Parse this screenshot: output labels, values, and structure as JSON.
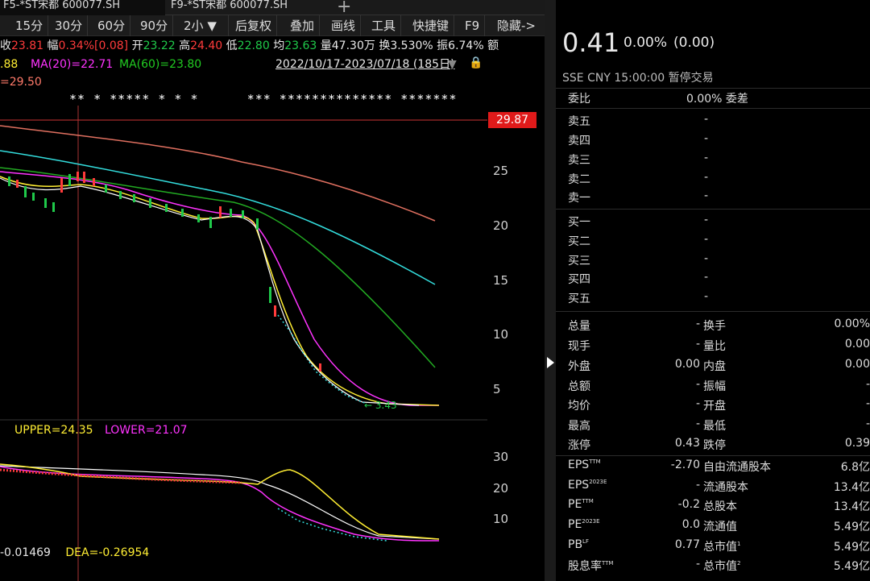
{
  "tabs": [
    {
      "label": "F5-*ST宋都 600077.SH",
      "active": true
    },
    {
      "label": "F9-*ST宋都 600077.SH",
      "active": false
    }
  ],
  "toolbar": [
    "15分",
    "30分",
    "60分",
    "90分",
    "2小",
    "后复权",
    "叠加",
    "画线",
    "工具",
    "快捷键",
    "F9",
    "隐藏->"
  ],
  "quote": {
    "close_label": "收",
    "close": "23.81",
    "range_label": "幅",
    "range": "0.34%[0.08]",
    "open_label": "开",
    "open": "23.22",
    "high_label": "高",
    "high": "24.40",
    "low_label": "低",
    "low": "22.80",
    "avg_label": "均",
    "avg": "23.63",
    "vol_label": "量",
    "vol": "47.30万",
    "turnover_label": "换",
    "turnover": "3.530%",
    "amp_label": "振",
    "amp": "6.74%",
    "amount_label": "额"
  },
  "ma": {
    "ma5": ".88",
    "ma20": "MA(20)=22.71",
    "ma60": "MA(60)=23.80",
    "prev": "=29.50",
    "date_range": "2022/10/17-2023/07/18 (185日)"
  },
  "marker_row": "** * ***** * * *      *** ************** *******",
  "main_axis": [
    "25",
    "20",
    "15",
    "10",
    "5"
  ],
  "price_tag": "29.87",
  "low_marker": "3.43",
  "boll": {
    "upper": "UPPER=24.35",
    "lower": "LOWER=21.07"
  },
  "sub_axis": [
    "30",
    "20",
    "10"
  ],
  "macd": {
    "dif": "-0.01469",
    "dea": "DEA=-0.26954"
  },
  "panel": {
    "price": "0.41",
    "chg_pct": "0.00%",
    "chg_val": "(0.00)",
    "sub_info": "SSE  CNY  15:00:00  暂停交易",
    "weibi_label": "委比",
    "weibi_val": "0.00% 委差",
    "sells": [
      {
        "label": "卖五",
        "val": "-"
      },
      {
        "label": "卖四",
        "val": "-"
      },
      {
        "label": "卖三",
        "val": "-"
      },
      {
        "label": "卖二",
        "val": "-"
      },
      {
        "label": "卖一",
        "val": "-"
      }
    ],
    "buys": [
      {
        "label": "买一",
        "val": "-"
      },
      {
        "label": "买二",
        "val": "-"
      },
      {
        "label": "买三",
        "val": "-"
      },
      {
        "label": "买四",
        "val": "-"
      },
      {
        "label": "买五",
        "val": "-"
      }
    ],
    "stats": [
      {
        "l": "总量",
        "lv": "-",
        "r": "换手",
        "rv": "0.00%",
        "lc": "",
        "rc": ""
      },
      {
        "l": "现手",
        "lv": "-",
        "r": "量比",
        "rv": "0.00",
        "lc": "",
        "rc": ""
      },
      {
        "l": "外盘",
        "lv": "0.00",
        "r": "内盘",
        "rv": "0.00",
        "lc": "red",
        "rc": "green"
      },
      {
        "l": "总额",
        "lv": "-",
        "r": "振幅",
        "rv": "-",
        "lc": "",
        "rc": ""
      },
      {
        "l": "均价",
        "lv": "-",
        "r": "开盘",
        "rv": "-",
        "lc": "",
        "rc": ""
      },
      {
        "l": "最高",
        "lv": "-",
        "r": "最低",
        "rv": "-",
        "lc": "",
        "rc": ""
      },
      {
        "l": "涨停",
        "lv": "0.43",
        "r": "跌停",
        "rv": "0.39",
        "lc": "red",
        "rc": "green"
      }
    ],
    "fundamentals": [
      {
        "l": "EPS",
        "sup": "TTM",
        "lv": "-2.70",
        "r": "自由流通股本",
        "rsup": "",
        "rv": "6.8亿"
      },
      {
        "l": "EPS",
        "sup": "2023E",
        "lv": "-",
        "r": "流通股本",
        "rsup": "",
        "rv": "13.4亿"
      },
      {
        "l": "PE",
        "sup": "TTM",
        "lv": "-0.2",
        "r": "总股本",
        "rsup": "",
        "rv": "13.4亿"
      },
      {
        "l": "PE",
        "sup": "2023E",
        "lv": "0.0",
        "r": "流通值",
        "rsup": "",
        "rv": "5.49亿"
      },
      {
        "l": "PB",
        "sup": "LF",
        "lv": "0.77",
        "r": "总市值",
        "rsup": "1",
        "rv": "5.49亿"
      },
      {
        "l": "股息率",
        "sup": "TTM",
        "lv": "-",
        "r": "总市值",
        "rsup": "2",
        "rv": "5.49亿"
      }
    ]
  },
  "colors": {
    "up": "#ff3b3b",
    "down": "#1fc94a",
    "ma5": "#ffffff",
    "ma10": "#ffee33",
    "ma20": "#ff33ff",
    "ma60": "#22aa22",
    "ma120": "#33dddd",
    "ma250": "#e07060"
  }
}
